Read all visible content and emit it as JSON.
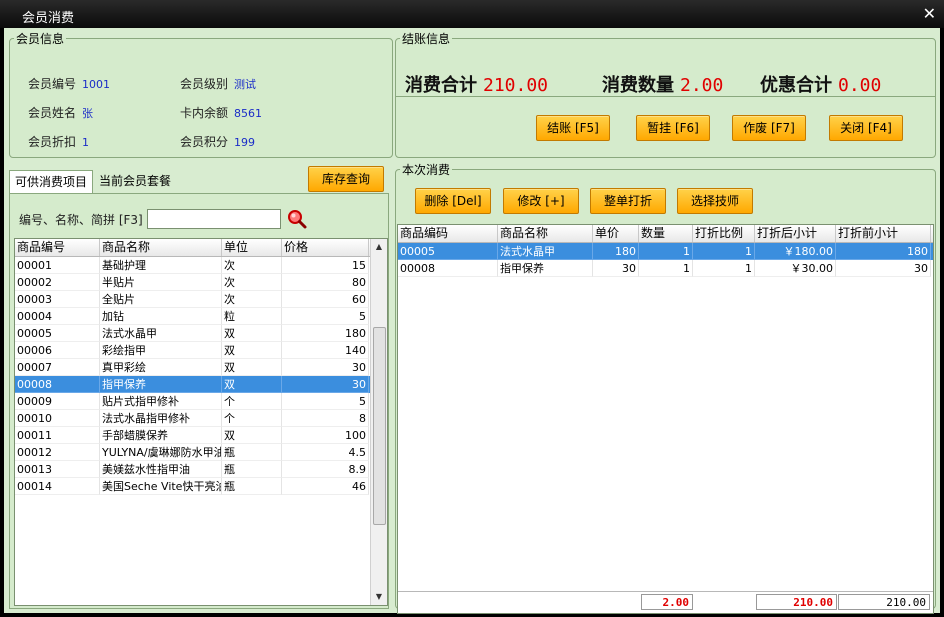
{
  "window": {
    "title": "会员消费",
    "close_glyph": "✕"
  },
  "member_info": {
    "legend": "会员信息",
    "fields": [
      {
        "label": "会员编号",
        "value": "1001"
      },
      {
        "label": "会员级别",
        "value": "测试"
      },
      {
        "label": "会员姓名",
        "value": "张"
      },
      {
        "label": "卡内余额",
        "value": "8561"
      },
      {
        "label": "会员折扣",
        "value": "1"
      },
      {
        "label": "会员积分",
        "value": "199"
      }
    ]
  },
  "checkout": {
    "legend": "结账信息",
    "total_label": "消费合计",
    "total_value": "210.00",
    "qty_label": "消费数量",
    "qty_value": "2.00",
    "discount_label": "优惠合计",
    "discount_value": "0.00",
    "buttons": [
      "结账 [F5]",
      "暂挂 [F6]",
      "作废 [F7]",
      "关闭 [F4]"
    ]
  },
  "left": {
    "tabs": [
      "可供消费项目",
      "当前会员套餐"
    ],
    "stock_button": "库存查询",
    "search_label": "编号、名称、简拼 [F3]",
    "search_value": "",
    "search_placeholder": "",
    "columns": [
      "商品编号",
      "商品名称",
      "单位",
      "价格"
    ],
    "rows": [
      [
        "00001",
        "基础护理",
        "次",
        "15"
      ],
      [
        "00002",
        "半贴片",
        "次",
        "80"
      ],
      [
        "00003",
        "全贴片",
        "次",
        "60"
      ],
      [
        "00004",
        "加钻",
        "粒",
        "5"
      ],
      [
        "00005",
        "法式水晶甲",
        "双",
        "180"
      ],
      [
        "00006",
        "彩绘指甲",
        "双",
        "140"
      ],
      [
        "00007",
        "真甲彩绘",
        "双",
        "30"
      ],
      [
        "00008",
        "指甲保养",
        "双",
        "30"
      ],
      [
        "00009",
        "贴片式指甲修补",
        "个",
        "5"
      ],
      [
        "00010",
        "法式水晶指甲修补",
        "个",
        "8"
      ],
      [
        "00011",
        "手部蜡膜保养",
        "双",
        "100"
      ],
      [
        "00012",
        "YULYNA/虞琳娜防水甲油",
        "瓶",
        "4.5"
      ],
      [
        "00013",
        "美媄兹水性指甲油",
        "瓶",
        "8.9"
      ],
      [
        "00014",
        "美国Seche Vite快干亮油",
        "瓶",
        "46"
      ]
    ],
    "selected_index": 7
  },
  "current": {
    "legend": "本次消费",
    "buttons": [
      "删除 [Del]",
      "修改 [+]",
      "整单打折",
      "选择技师"
    ],
    "columns": [
      "商品编码",
      "商品名称",
      "单价",
      "数量",
      "打折比例",
      "打折后小计",
      "打折前小计"
    ],
    "rows": [
      [
        "00005",
        "法式水晶甲",
        "180",
        "1",
        "1",
        "￥180.00",
        "180"
      ],
      [
        "00008",
        "指甲保养",
        "30",
        "1",
        "1",
        "￥30.00",
        "30"
      ]
    ],
    "selected_index": 0,
    "footer": {
      "qty_total": "2.00",
      "after_total": "210.00",
      "before_total": "210.00"
    }
  },
  "colors": {
    "accent_red": "#e00000",
    "selection": "#3b8ede",
    "button": "#ffb000",
    "panel": "#d5ebcc"
  },
  "icons": {
    "search": "search-icon",
    "close": "close-icon"
  }
}
